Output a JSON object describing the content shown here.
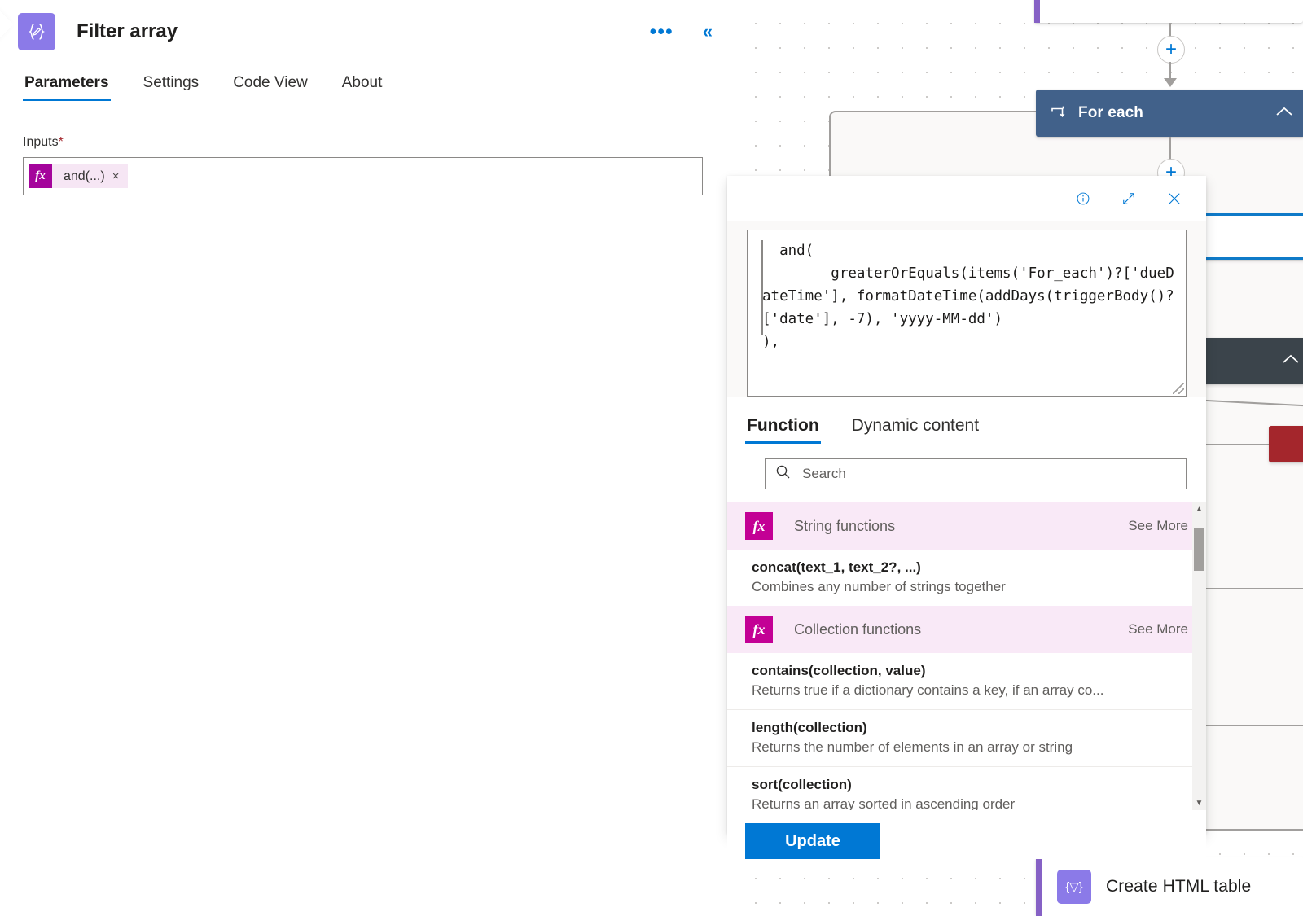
{
  "panel": {
    "icon_name": "data-operation-icon",
    "title": "Filter array",
    "more_label": "•••",
    "collapse_label": "«",
    "tabs": [
      {
        "label": "Parameters",
        "active": true
      },
      {
        "label": "Settings",
        "active": false
      },
      {
        "label": "Code View",
        "active": false
      },
      {
        "label": "About",
        "active": false
      }
    ],
    "inputs": {
      "label": "Inputs",
      "required_marker": "*",
      "token": {
        "fx": "fx",
        "text": "and(...)",
        "remove": "×"
      }
    }
  },
  "expression_callout": {
    "toolbar": {
      "info_label": "i",
      "expand_label": "expand",
      "close_label": "×"
    },
    "expression": "  and(\n        greaterOrEquals(items('For_each')?['dueDateTime'], formatDateTime(addDays(triggerBody()?['date'], -7), 'yyyy-MM-dd')\n),",
    "tabs": [
      {
        "label": "Function",
        "active": true
      },
      {
        "label": "Dynamic content",
        "active": false
      }
    ],
    "search": {
      "placeholder": "Search",
      "value": "",
      "icon": "search-icon"
    },
    "groups": [
      {
        "name": "String functions",
        "see_more": "See More",
        "items": [
          {
            "signature": "concat(text_1, text_2?, ...)",
            "description": "Combines any number of strings together"
          }
        ]
      },
      {
        "name": "Collection functions",
        "see_more": "See More",
        "items": [
          {
            "signature": "contains(collection, value)",
            "description": "Returns true if a dictionary contains a key, if an array co..."
          },
          {
            "signature": "length(collection)",
            "description": "Returns the number of elements in an array or string"
          },
          {
            "signature": "sort(collection)",
            "description": "Returns an array sorted in ascending order"
          }
        ]
      }
    ],
    "update_button": "Update"
  },
  "canvas": {
    "nodes": {
      "for_each": {
        "label": "For each",
        "icon": "loop-icon",
        "chevron": "chevron-up-icon"
      },
      "create_html_table": {
        "label": "Create HTML table",
        "icon": "data-operation-icon"
      }
    },
    "add_button_label": "+"
  },
  "colors": {
    "accent_blue": "#0078d4",
    "purple": "#8b7ae8",
    "magenta": "#c30095",
    "token_magenta": "#a4049b",
    "foreach_blue": "#41618a",
    "dark_node": "#3b444b",
    "red_node": "#a4262c",
    "required_red": "#a4262c"
  }
}
